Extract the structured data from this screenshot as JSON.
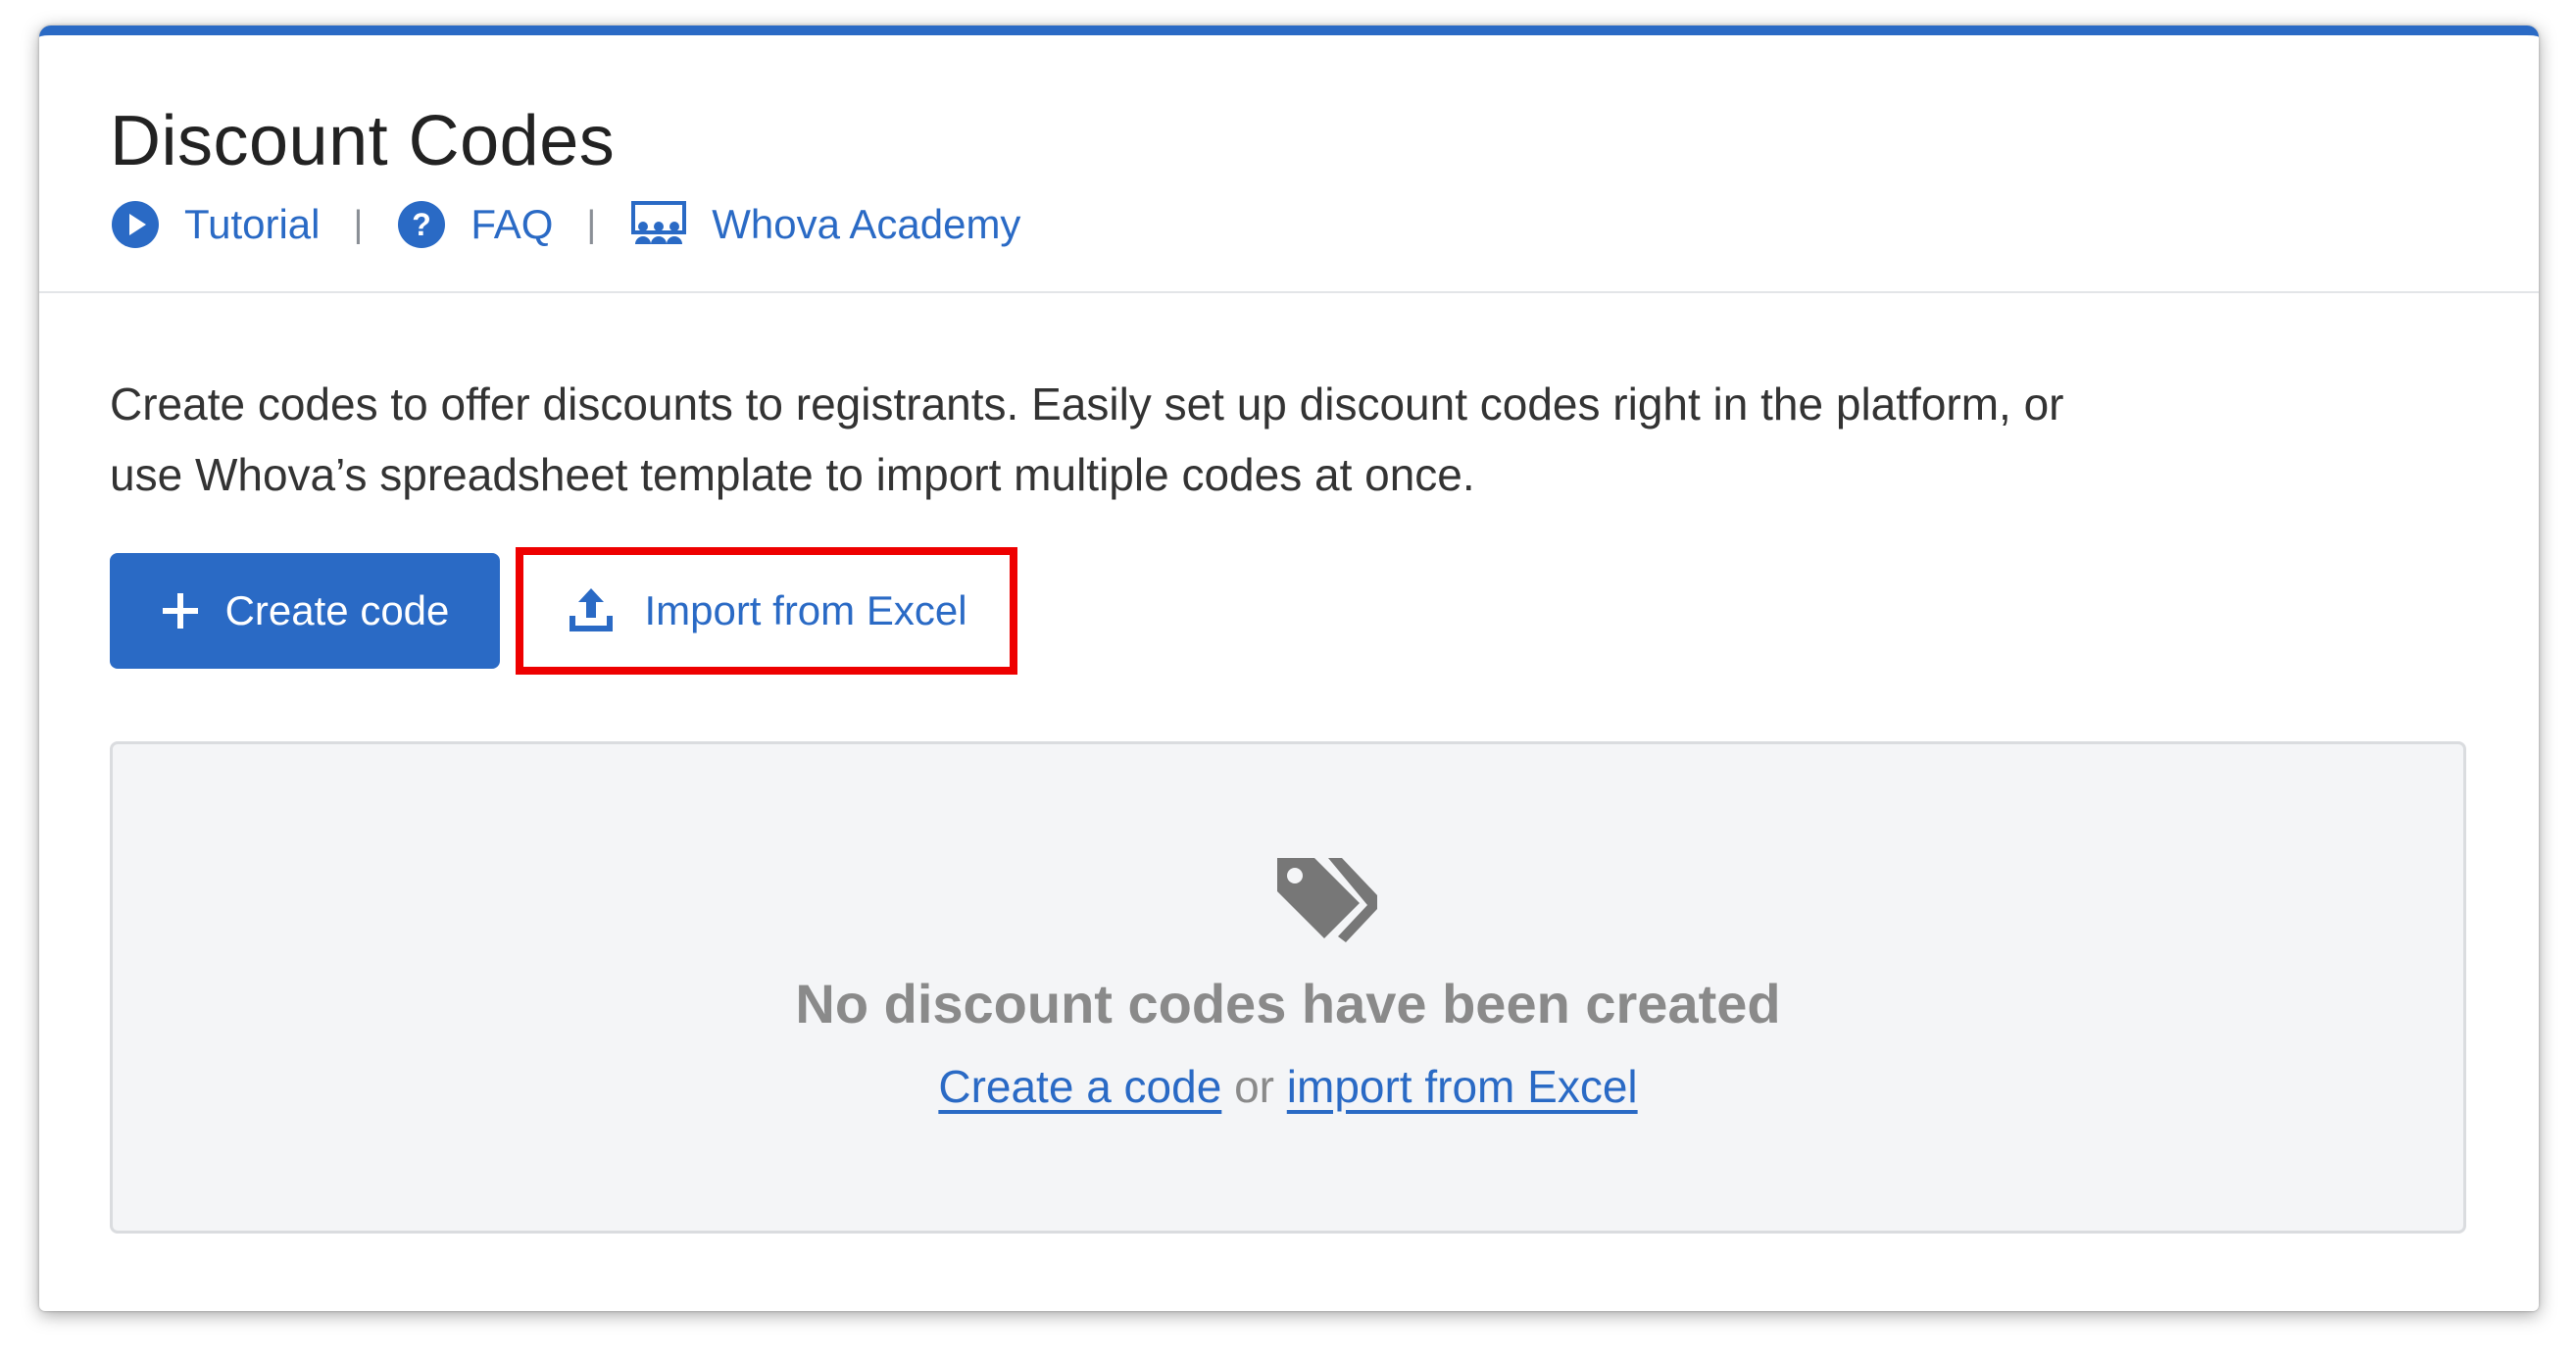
{
  "header": {
    "title": "Discount Codes",
    "links": {
      "tutorial": "Tutorial",
      "faq": "FAQ",
      "academy": "Whova Academy",
      "separator": "|"
    }
  },
  "description": "Create codes to offer discounts to registrants. Easily set up discount codes right in the platform, or use Whova’s spreadsheet template to import multiple codes at once.",
  "actions": {
    "create_label": "Create code",
    "import_label": "Import from Excel"
  },
  "empty_state": {
    "title": "No discount codes have been created",
    "create_link": "Create a code",
    "or_text": " or ",
    "import_link": "import from Excel"
  },
  "icons": {
    "tutorial": "play-circle-icon",
    "faq": "question-circle-icon",
    "academy": "academy-icon",
    "create": "plus-icon",
    "import": "upload-icon",
    "empty": "tags-icon"
  },
  "colors": {
    "accent": "#2a6ac5",
    "highlight_border": "#ee0000",
    "muted_text": "#8a8a8a"
  }
}
